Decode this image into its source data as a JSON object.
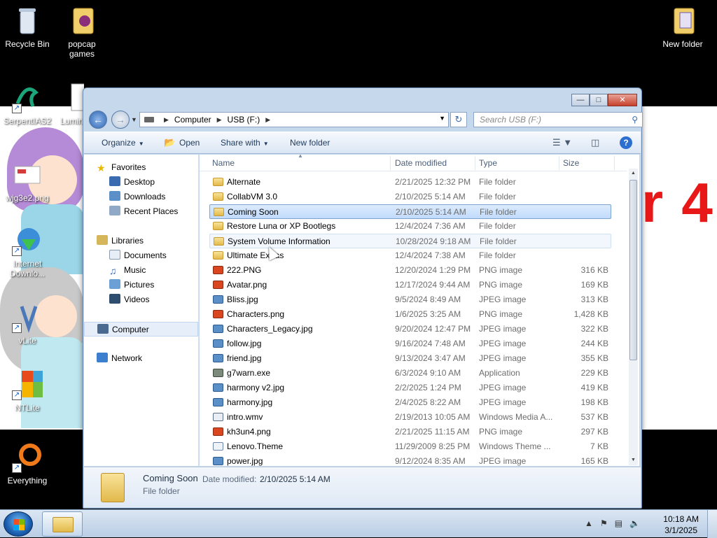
{
  "desktop": {
    "icons": [
      {
        "label": "Recycle Bin"
      },
      {
        "label": "popcap games"
      },
      {
        "label": "New folder"
      },
      {
        "label": "SerpentIAS2"
      },
      {
        "label": "Lumin"
      },
      {
        "label": "wjg3e2.png"
      },
      {
        "label": "Internet Downlo..."
      },
      {
        "label": "vLite"
      },
      {
        "label": "NTLite"
      },
      {
        "label": "Everything"
      }
    ],
    "wallpaper_text": "r 4"
  },
  "window": {
    "address": {
      "path": [
        "Computer",
        "USB (F:)"
      ]
    },
    "search_placeholder": "Search USB (F:)",
    "toolbar": {
      "organize": "Organize",
      "open": "Open",
      "share_with": "Share with",
      "new_folder": "New folder"
    },
    "nav": {
      "favorites": "Favorites",
      "desktop": "Desktop",
      "downloads": "Downloads",
      "recent": "Recent Places",
      "libraries": "Libraries",
      "documents": "Documents",
      "music": "Music",
      "pictures": "Pictures",
      "videos": "Videos",
      "computer": "Computer",
      "network": "Network"
    },
    "columns": {
      "name": "Name",
      "date": "Date modified",
      "type": "Type",
      "size": "Size"
    },
    "files": [
      {
        "name": "Alternate",
        "date": "2/21/2025 12:32 PM",
        "type": "File folder",
        "size": "",
        "kind": "folder"
      },
      {
        "name": "CollabVM 3.0",
        "date": "2/10/2025 5:14 AM",
        "type": "File folder",
        "size": "",
        "kind": "folder"
      },
      {
        "name": "Coming Soon",
        "date": "2/10/2025 5:14 AM",
        "type": "File folder",
        "size": "",
        "kind": "folder"
      },
      {
        "name": "Restore Luna or XP Bootlegs",
        "date": "12/4/2024 7:36 AM",
        "type": "File folder",
        "size": "",
        "kind": "folder"
      },
      {
        "name": "System Volume Information",
        "date": "10/28/2024 9:18 AM",
        "type": "File folder",
        "size": "",
        "kind": "folder"
      },
      {
        "name": "Ultimate Extras",
        "date": "12/4/2024 7:38 AM",
        "type": "File folder",
        "size": "",
        "kind": "folder"
      },
      {
        "name": "222.PNG",
        "date": "12/20/2024 1:29 PM",
        "type": "PNG image",
        "size": "316 KB",
        "kind": "png"
      },
      {
        "name": "Avatar.png",
        "date": "12/17/2024 9:44 AM",
        "type": "PNG image",
        "size": "169 KB",
        "kind": "png"
      },
      {
        "name": "Bliss.jpg",
        "date": "9/5/2024 8:49 AM",
        "type": "JPEG image",
        "size": "313 KB",
        "kind": "jpg"
      },
      {
        "name": "Characters.png",
        "date": "1/6/2025 3:25 AM",
        "type": "PNG image",
        "size": "1,428 KB",
        "kind": "png"
      },
      {
        "name": "Characters_Legacy.jpg",
        "date": "9/20/2024 12:47 PM",
        "type": "JPEG image",
        "size": "322 KB",
        "kind": "jpg"
      },
      {
        "name": "follow.jpg",
        "date": "9/16/2024 7:48 AM",
        "type": "JPEG image",
        "size": "244 KB",
        "kind": "jpg"
      },
      {
        "name": "friend.jpg",
        "date": "9/13/2024 3:47 AM",
        "type": "JPEG image",
        "size": "355 KB",
        "kind": "jpg"
      },
      {
        "name": "g7warn.exe",
        "date": "6/3/2024 9:10 AM",
        "type": "Application",
        "size": "229 KB",
        "kind": "app"
      },
      {
        "name": "harmony v2.jpg",
        "date": "2/2/2025 1:24 PM",
        "type": "JPEG image",
        "size": "419 KB",
        "kind": "jpg"
      },
      {
        "name": "harmony.jpg",
        "date": "2/4/2025 8:22 AM",
        "type": "JPEG image",
        "size": "198 KB",
        "kind": "jpg"
      },
      {
        "name": "intro.wmv",
        "date": "2/19/2013 10:05 AM",
        "type": "Windows Media A...",
        "size": "537 KB",
        "kind": "wmv"
      },
      {
        "name": "kh3un4.png",
        "date": "2/21/2025 11:15 AM",
        "type": "PNG image",
        "size": "297 KB",
        "kind": "png"
      },
      {
        "name": "Lenovo.Theme",
        "date": "11/29/2009 8:25 PM",
        "type": "Windows Theme ...",
        "size": "7 KB",
        "kind": "theme"
      },
      {
        "name": "power.jpg",
        "date": "9/12/2024 8:35 AM",
        "type": "JPEG image",
        "size": "165 KB",
        "kind": "jpg"
      }
    ],
    "details": {
      "name": "Coming Soon",
      "date_label": "Date modified:",
      "date_value": "2/10/2025 5:14 AM",
      "type": "File folder"
    }
  },
  "taskbar": {
    "time": "10:18 AM",
    "date": "3/1/2025"
  },
  "colors": {
    "selection": "#c1dbfc",
    "accent": "#2c63b3",
    "taskbar": "#b9cde4"
  }
}
